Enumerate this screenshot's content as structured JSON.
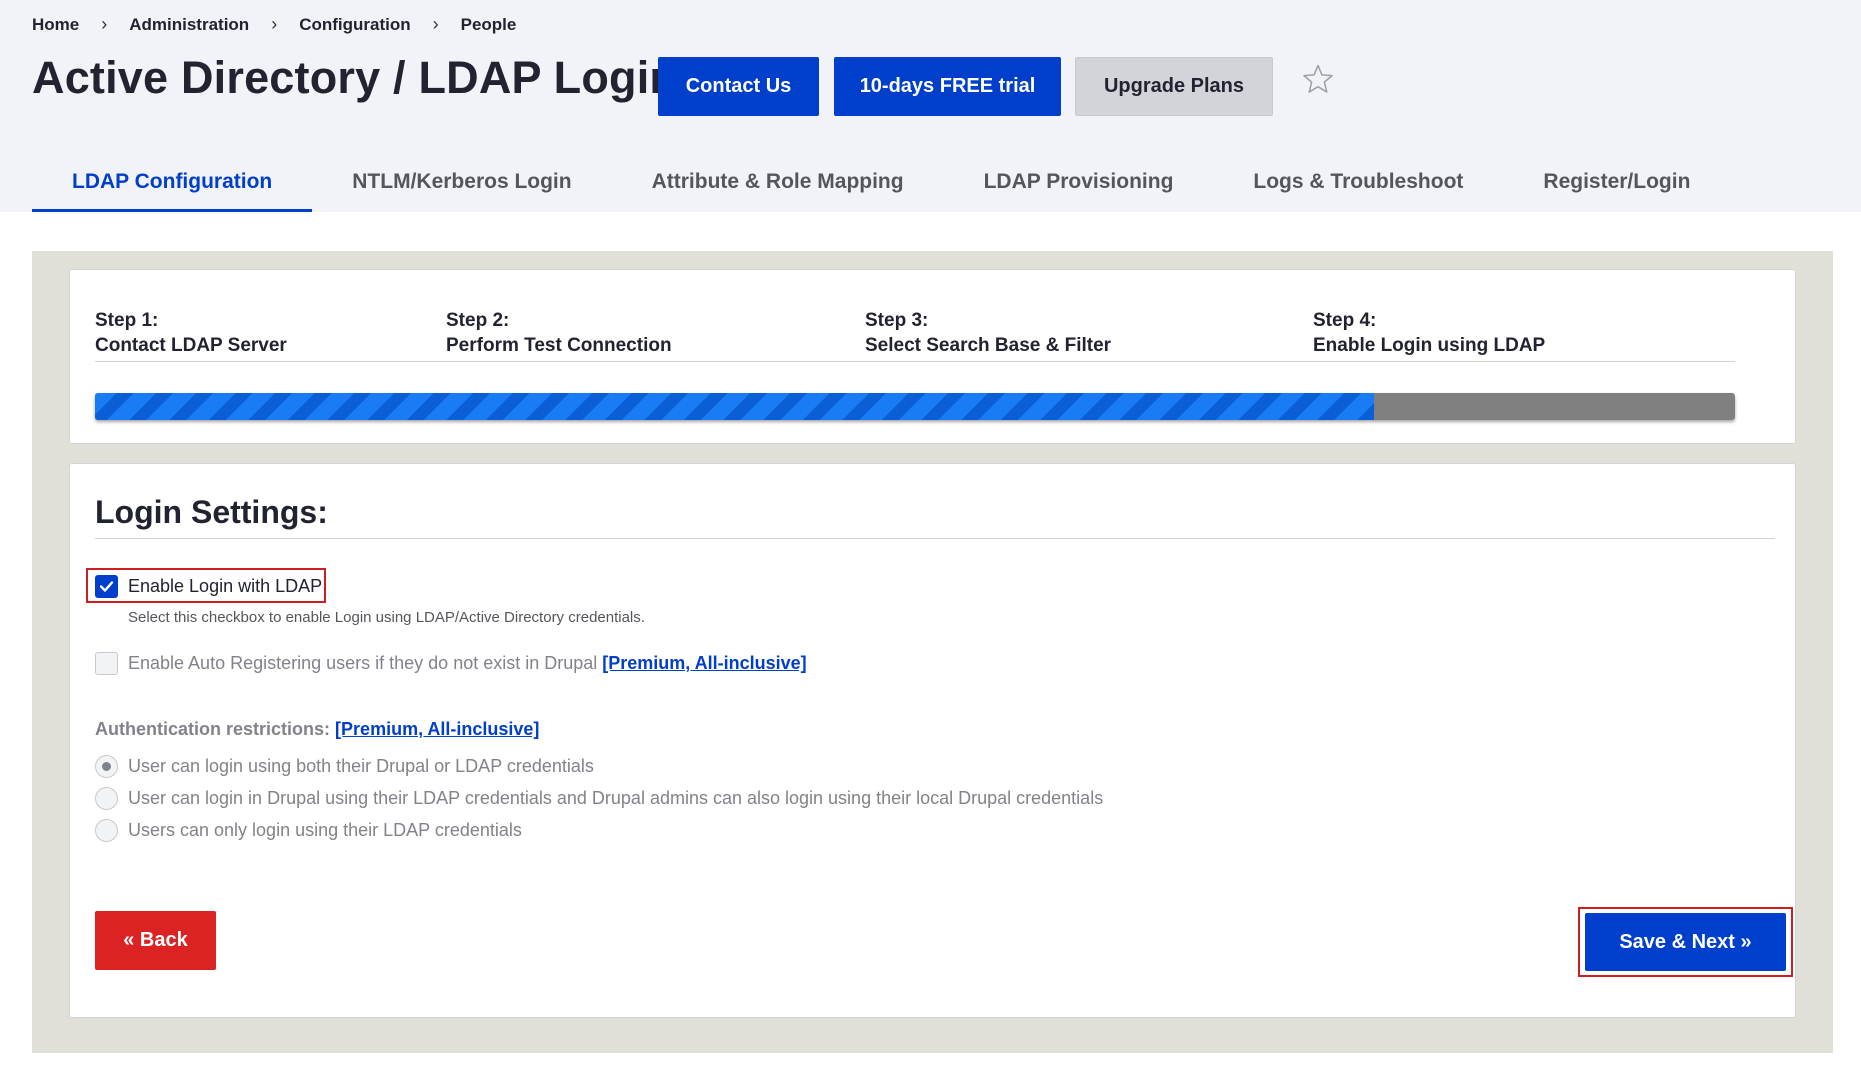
{
  "breadcrumb": {
    "items": [
      "Home",
      "Administration",
      "Configuration",
      "People"
    ],
    "separator": "›"
  },
  "header": {
    "title": "Active Directory / LDAP Login",
    "contact_label": "Contact Us",
    "trial_label": "10-days FREE trial",
    "upgrade_label": "Upgrade Plans",
    "star_icon": "star-outline"
  },
  "tabs": [
    {
      "label": "LDAP Configuration",
      "active": true
    },
    {
      "label": "NTLM/Kerberos Login",
      "active": false
    },
    {
      "label": "Attribute & Role Mapping",
      "active": false
    },
    {
      "label": "LDAP Provisioning",
      "active": false
    },
    {
      "label": "Logs & Troubleshoot",
      "active": false
    },
    {
      "label": "Register/Login",
      "active": false
    }
  ],
  "steps": [
    {
      "number": "Step 1:",
      "title": "Contact LDAP Server"
    },
    {
      "number": "Step 2:",
      "title": "Perform Test Connection"
    },
    {
      "number": "Step 3:",
      "title": "Select Search Base & Filter"
    },
    {
      "number": "Step 4:",
      "title": "Enable Login using LDAP"
    }
  ],
  "progress": {
    "fraction": 0.78
  },
  "login_settings": {
    "title": "Login Settings:",
    "enable_login": {
      "label": "Enable Login with LDAP",
      "checked": true,
      "help": "Select this checkbox to enable Login using LDAP/Active Directory credentials."
    },
    "auto_register": {
      "label": "Enable Auto Registering users if they do not exist in Drupal",
      "link": "[Premium, All-inclusive]",
      "checked": false,
      "disabled": true
    },
    "auth_restrictions": {
      "label": "Authentication restrictions:",
      "link": "[Premium, All-inclusive]",
      "options": [
        {
          "label": "User can login using both their Drupal or LDAP credentials",
          "selected": true
        },
        {
          "label": "User can login in Drupal using their LDAP credentials and Drupal admins can also login using their local Drupal credentials",
          "selected": false
        },
        {
          "label": "Users can only login using their LDAP credentials",
          "selected": false
        }
      ]
    }
  },
  "actions": {
    "back_label": "« Back",
    "save_label": "Save & Next »"
  },
  "colors": {
    "primary": "#003ecc",
    "danger": "#dc2323",
    "progress": "#007bff",
    "highlight": "#cc1f1f"
  }
}
